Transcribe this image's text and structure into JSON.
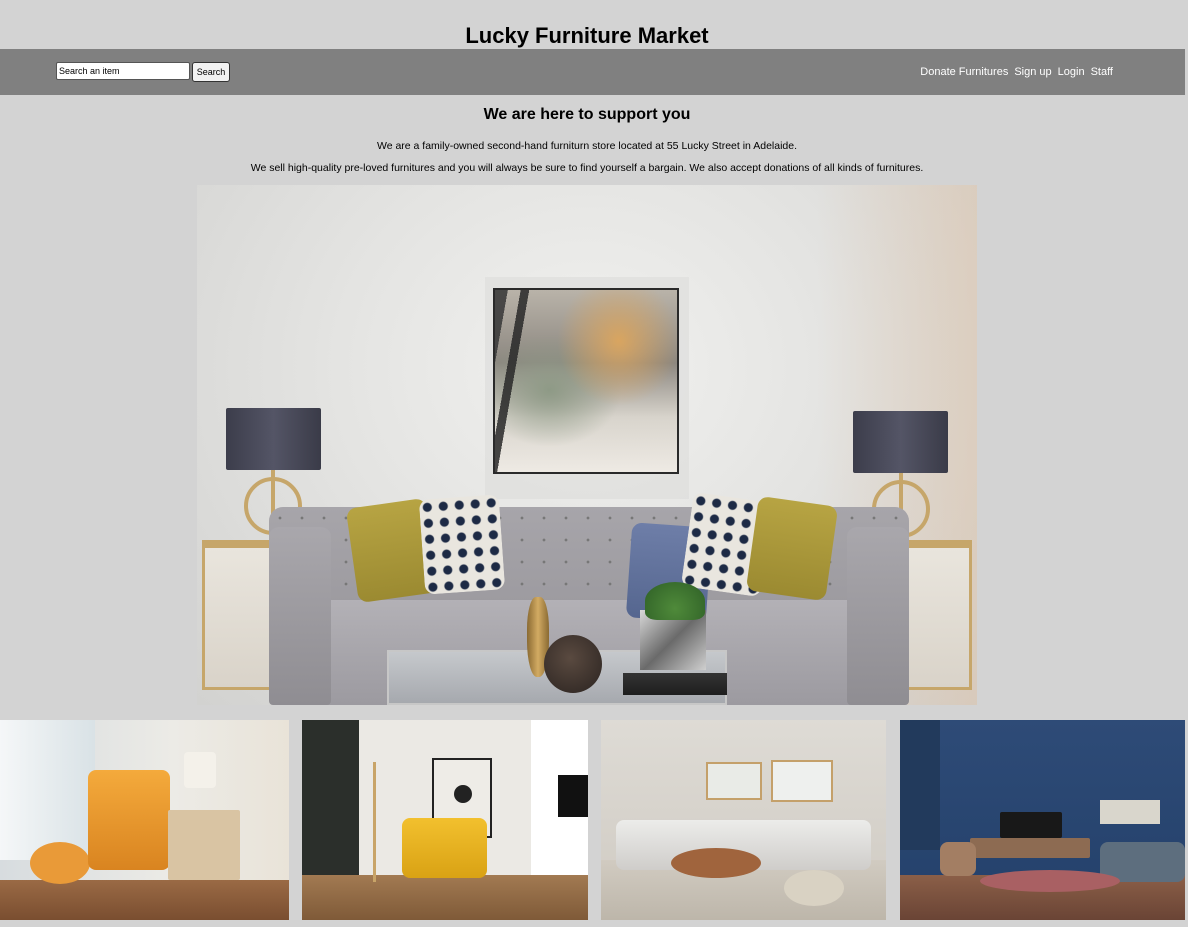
{
  "site": {
    "title": "Lucky Furniture Market"
  },
  "navbar": {
    "search_value": "Search an item",
    "search_button": "Search",
    "links": [
      "Donate Furnitures",
      "Sign up",
      "Login",
      "Staff"
    ]
  },
  "intro": {
    "heading": "We are here to support you",
    "line1": "We are a family-owned second-hand furniturn store located at 55 Lucky Street in Adelaide.",
    "line2": "We sell high-quality pre-loved furnitures and you will always be sure to find yourself a bargain. We also accept donations of all kinds of furnitures."
  },
  "colors": {
    "background": "#d3d3d3",
    "navbar": "#808080",
    "nav_link": "#ffffff"
  },
  "images": {
    "hero": "living-room-hero-image",
    "gallery": [
      "orange-armchair-bedroom",
      "yellow-chair-floor-lamp",
      "cream-sofa-wooden-tables",
      "blue-living-room-tv"
    ]
  }
}
